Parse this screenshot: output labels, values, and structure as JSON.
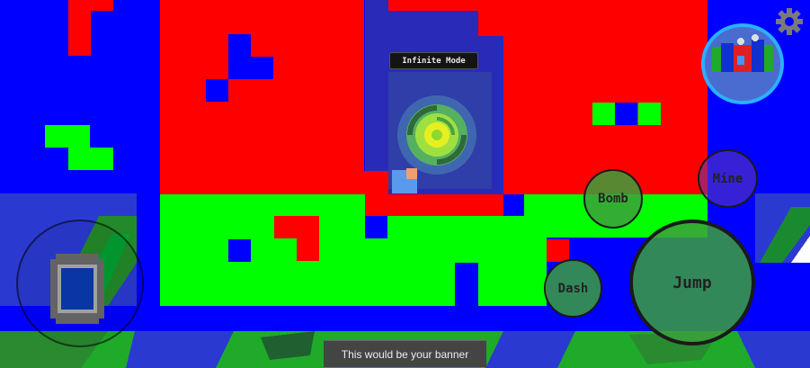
{
  "hud": {
    "mode_label": "Infinite Mode",
    "banner_text": "This would be your banner"
  },
  "controls": {
    "bomb_label": "Bomb",
    "mine_label": "Mine",
    "dash_label": "Dash",
    "jump_label": "Jump"
  },
  "icons": {
    "settings": "gear-icon",
    "portal": "swirl-portal-icon",
    "joystick": "joystick-knob-icon"
  },
  "colors": {
    "wall_blue": "#0000ff",
    "wall_red": "#ff0000",
    "floor_green": "#00ff00",
    "button_green": "#3ca03c",
    "minimap_ring": "#2ab0ff",
    "banner_bg": "#444444"
  }
}
